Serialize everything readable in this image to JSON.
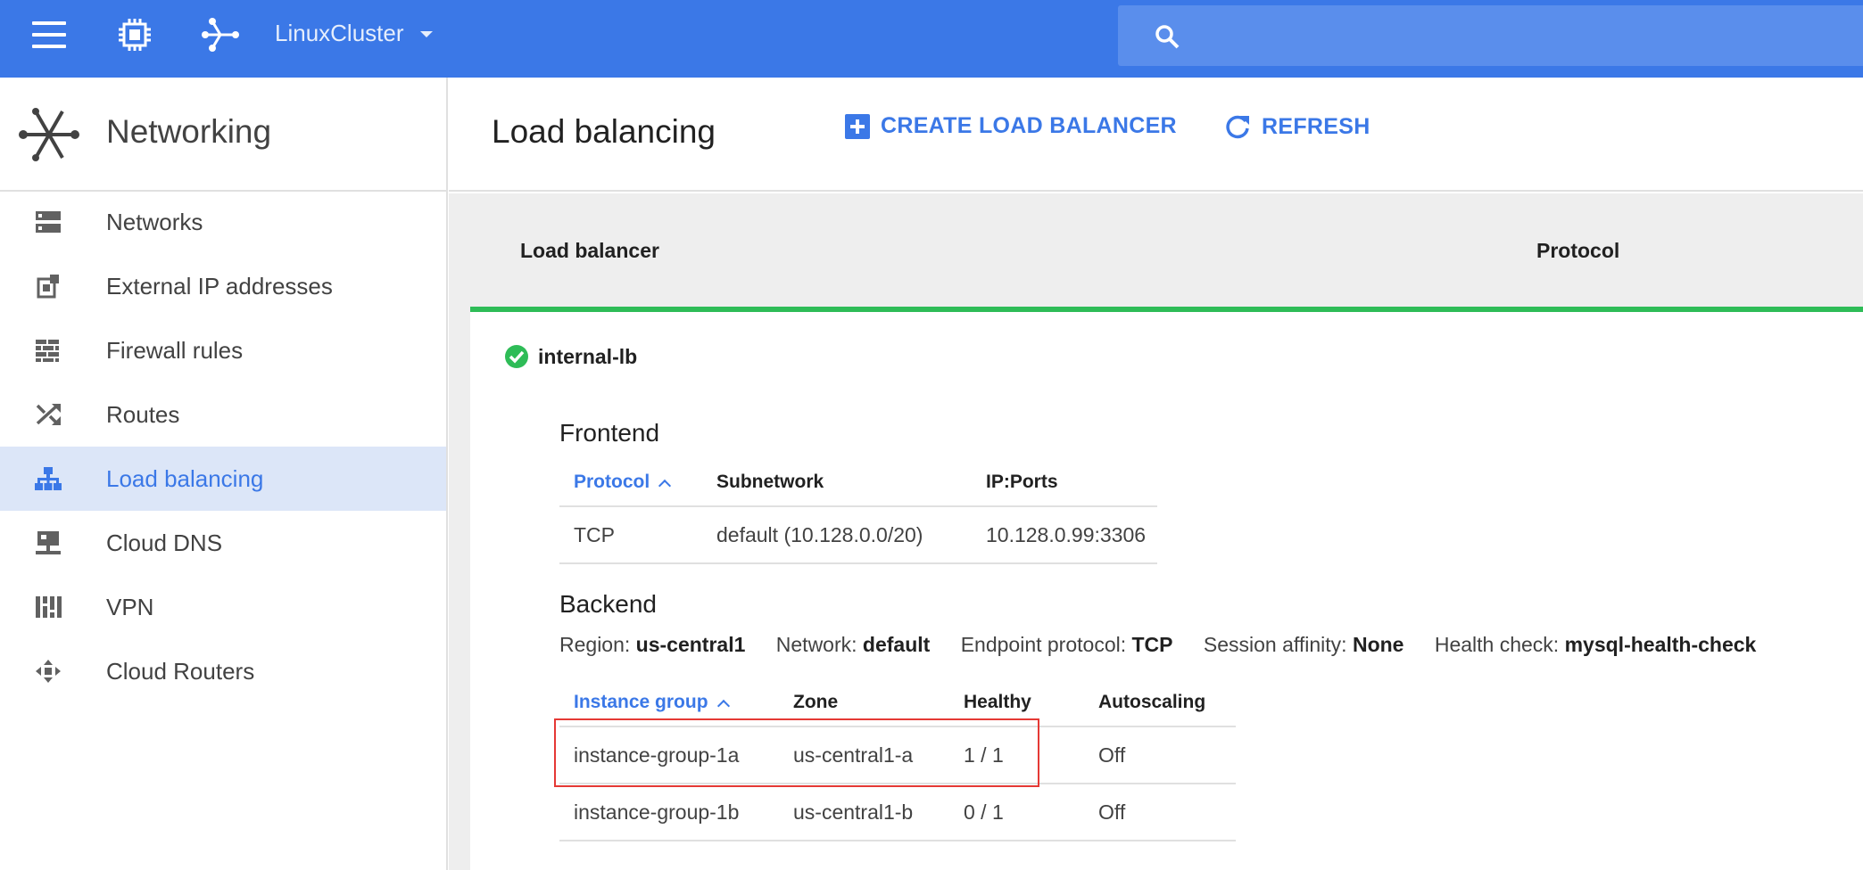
{
  "topbar": {
    "project": "LinuxCluster",
    "menu_icon": "hamburger-menu-icon",
    "product_icon": "compute-chip-icon",
    "networking_icon": "network-node-icon",
    "search_icon": "search-icon",
    "colors": {
      "bar": "#3b78e7",
      "search": "#5a8eec"
    }
  },
  "sidebar": {
    "title": "Networking",
    "items": [
      {
        "label": "Networks",
        "icon": "networks-icon",
        "active": false
      },
      {
        "label": "External IP addresses",
        "icon": "external-ip-icon",
        "active": false
      },
      {
        "label": "Firewall rules",
        "icon": "firewall-icon",
        "active": false
      },
      {
        "label": "Routes",
        "icon": "routes-icon",
        "active": false
      },
      {
        "label": "Load balancing",
        "icon": "load-balancing-icon",
        "active": true
      },
      {
        "label": "Cloud DNS",
        "icon": "cloud-dns-icon",
        "active": false
      },
      {
        "label": "VPN",
        "icon": "vpn-icon",
        "active": false
      },
      {
        "label": "Cloud Routers",
        "icon": "cloud-routers-icon",
        "active": false
      }
    ]
  },
  "header": {
    "title": "Load balancing",
    "create_label": "CREATE LOAD BALANCER",
    "refresh_label": "REFRESH"
  },
  "list": {
    "col_load_balancer": "Load balancer",
    "col_protocol": "Protocol"
  },
  "lb": {
    "name": "internal-lb",
    "status": "healthy",
    "status_color": "#2ebc57",
    "frontend": {
      "title": "Frontend",
      "headers": [
        "Protocol",
        "Subnetwork",
        "IP:Ports"
      ],
      "rows": [
        [
          "TCP",
          "default (10.128.0.0/20)",
          "10.128.0.99:3306"
        ]
      ]
    },
    "backend": {
      "title": "Backend",
      "meta": {
        "region_label": "Region:",
        "region": "us-central1",
        "network_label": "Network:",
        "network": "default",
        "endpoint_label": "Endpoint protocol:",
        "endpoint": "TCP",
        "affinity_label": "Session affinity:",
        "affinity": "None",
        "health_label": "Health check:",
        "health": "mysql-health-check"
      },
      "headers": [
        "Instance group",
        "Zone",
        "Healthy",
        "Autoscaling"
      ],
      "rows": [
        [
          "instance-group-1a",
          "us-central1-a",
          "1 / 1",
          "Off"
        ],
        [
          "instance-group-1b",
          "us-central1-b",
          "0 / 1",
          "Off"
        ]
      ],
      "highlight_color": "#e53935"
    }
  }
}
